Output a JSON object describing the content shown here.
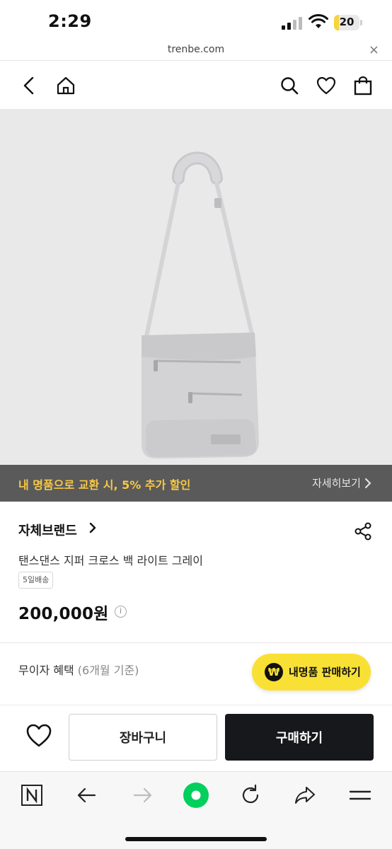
{
  "status_bar": {
    "time": "2:29",
    "battery_level": "20",
    "battery_fraction": 0.2,
    "battery_color": "#f7d43a"
  },
  "url_bar": {
    "domain": "trenbe.com",
    "close_glyph": "×"
  },
  "nav": {
    "icons": [
      "back-icon",
      "home-icon",
      "search-icon",
      "heart-icon",
      "shopping-bag-icon"
    ]
  },
  "promo_banner": {
    "text": "내 명품으로 교환 시, 5% 추가 할인",
    "link_label": "자세히보기",
    "text_color": "#f7c846",
    "background": "#5a5a5a"
  },
  "product": {
    "brand": "자체브랜드",
    "name": "탠스댄스 지퍼 크로스 백 라이트 그레이",
    "delivery_badge": "5일배송",
    "price": "200,000원",
    "price_info_glyph": "i"
  },
  "interest_free": {
    "label": "무이자 혜택",
    "detail": "(6개월 기준)"
  },
  "sell_button": {
    "coin_glyph": "₩",
    "label": "내명품 판매하기",
    "color": "#f9e034"
  },
  "actions": {
    "cart_label": "장바구니",
    "buy_label": "구매하기",
    "buy_color": "#16181b"
  },
  "browser_toolbar": {
    "icons": [
      "naver-n-icon",
      "back-arrow-icon",
      "forward-arrow-icon",
      "green-dot-icon",
      "refresh-icon",
      "share-arrow-icon",
      "menu-icon"
    ],
    "accent": "#03cf5d"
  }
}
